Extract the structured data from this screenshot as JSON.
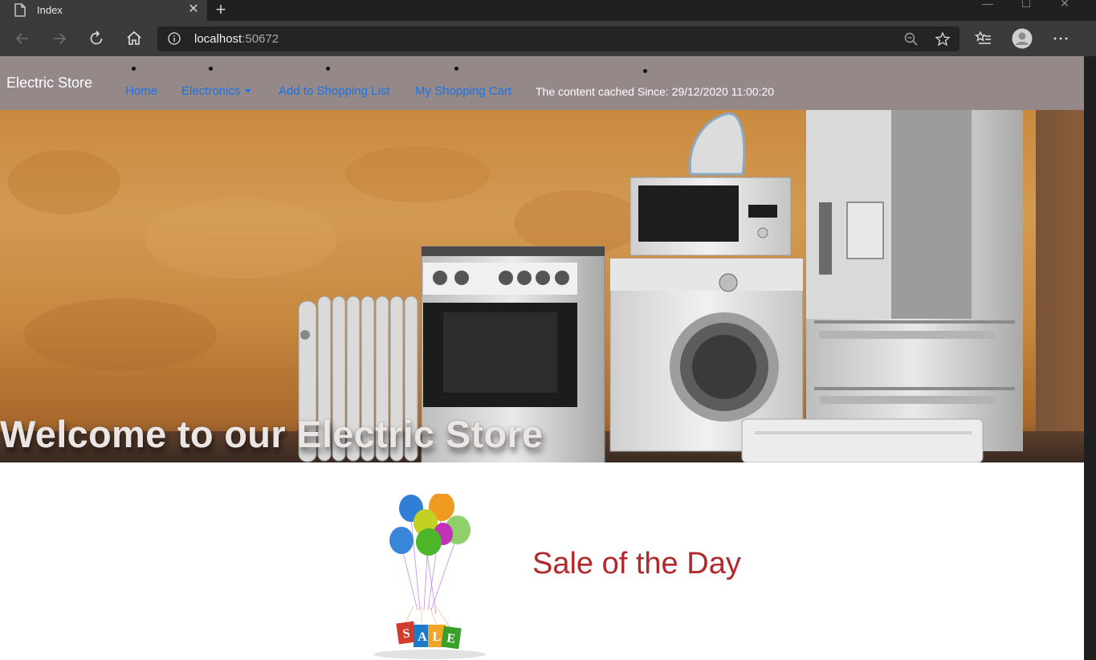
{
  "browser": {
    "tab_title": "Index",
    "url_host": "localhost",
    "url_port": ":50672"
  },
  "site": {
    "brand": "Electric Store",
    "nav": {
      "home": "Home",
      "electronics": "Electronics",
      "add_to_list": "Add to Shopping List",
      "cart": "My Shopping Cart",
      "cache_text": "The content cached Since: 29/12/2020 11:00:20"
    },
    "hero_title": "Welcome to our Electric Store",
    "sale": {
      "title": "Sale of the Day",
      "bag_letters": [
        "S",
        "A",
        "L",
        "E"
      ]
    }
  },
  "colors": {
    "nav_bg": "#958888",
    "link": "#1a73e8",
    "sale_title": "#b3282d"
  },
  "icons": {
    "back": "arrow-left",
    "forward": "arrow-right",
    "refresh": "refresh",
    "home": "home",
    "info": "info-circle",
    "zoom": "magnifier",
    "favorite": "star",
    "favorites_list": "star-list",
    "profile": "user-avatar",
    "more": "ellipsis"
  }
}
